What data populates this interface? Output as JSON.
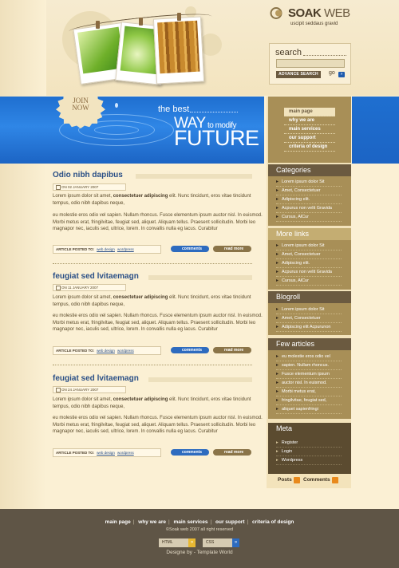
{
  "brand": {
    "name": "SOAK",
    "name_suffix": "WEB",
    "tagline": "uscipit seddaus gravid"
  },
  "search": {
    "label": "search",
    "advanced_label": "ADVANCE SEARCH",
    "go_label": "go",
    "go_arrow": "»"
  },
  "banner": {
    "join_line1": "JOIN",
    "join_line2": "NOW",
    "small": "the best",
    "way": "WAY",
    "way_suffix": "to modify",
    "future": "FUTURE"
  },
  "nav": [
    "main page",
    "why we are",
    "main services",
    "our support",
    "criteria of design"
  ],
  "categories": {
    "title": "Categories",
    "items": [
      "Lorem ipsum dolor Sit",
      "Amet, Consectetuer",
      "Adipiscing elit.",
      "Acpurus non velit Gravida",
      "Cursus, AlCur"
    ]
  },
  "more_links": {
    "title": "More links",
    "items": [
      "Lorem ipsum dolor Sit",
      "Amet, Consectetuer",
      "Adipiscing elit.",
      "Acpurus non velit Gravida",
      "Cursus, AlCur"
    ]
  },
  "blogroll": {
    "title": "Blogroll",
    "items": [
      "Lorem ipsum dolor Sit",
      "Amet, Consectetuer",
      "Adipiscing elit Acpurunon"
    ]
  },
  "few_articles": {
    "title": "Few articles",
    "items": [
      "eu molestie eros odio vel",
      "sapien. Nullam rhoncus.",
      "Fusce elementum ipsum",
      "auctor nisl. In euismod.",
      "Morbi metus erat,",
      "fringilvitae, feugiat sed,",
      "aliquet sapienfringi"
    ]
  },
  "meta": {
    "title": "Meta",
    "items": [
      "Register",
      "Login",
      "Wordpress"
    ]
  },
  "feeds": {
    "posts": "Posts",
    "comments": "Comments"
  },
  "posts": [
    {
      "title": "Odio nibh dapibus",
      "date": "ON 02 JANUARY 2007",
      "p1_start": "Lorem ipsum dolor sit amet, ",
      "p1_bold": "consectetuer adipiscing",
      "p1_end": " elit. Nunc tincidunt, eros vitae tincidunt tempus, odio nibh dapibus neque,",
      "p2": "eu molestie eros odio vel sapien. Nullam rhoncus. Fusce elementum ipsum auctor nisl. In euismod. Morbi metus erat, fringilvitae, feugiat sed, aliquet. Aliquam tellus. Praesent sollicitudin. Morbi leo magnapor nec, iaculis sed, ultrice, lorem. In convallis nulla eg lacus. Curabitur",
      "posted_to": "ARTICLE POSTED TO:",
      "tag1": "web design",
      "tag2": "wordpress",
      "comments": "comments",
      "read_more": "read more"
    },
    {
      "title": "feugiat sed lvitaemagn",
      "date": "ON 11 JANUARY 2007",
      "p1_start": "Lorem ipsum dolor sit amet, ",
      "p1_bold": "consectetuer adipiscing",
      "p1_end": " elit. Nunc tincidunt, eros vitae tincidunt tempus, odio nibh dapibus neque,",
      "p2": "eu molestie eros odio vel sapien. Nullam rhoncus. Fusce elementum ipsum auctor nisl. In euismod. Morbi metus erat, fringilvitae, feugiat sed, aliquet. Aliquam tellus. Praesent sollicitudin. Morbi leo magnapor nec, iaculis sed, ultrice, lorem. In convallis nulla eg lacus. Curabitur",
      "posted_to": "ARTICLE POSTED TO:",
      "tag1": "web design",
      "tag2": "wordpress",
      "comments": "comments",
      "read_more": "read more"
    },
    {
      "title": "feugiat sed lvitaemagn",
      "date": "ON 24 JANUARY 2007",
      "p1_start": "Lorem ipsum dolor sit amet, ",
      "p1_bold": "consectetuer adipiscing",
      "p1_end": " elit. Nunc tincidunt, eros vitae tincidunt tempus, odio nibh dapibus neque,",
      "p2": "eu molestie eros odio vel sapien. Nullam rhoncus. Fusce elementum ipsum auctor nisl. In euismod. Morbi metus erat, fringilvitae, feugiat sed, aliquet. Aliquam tellus. Praesent sollicitudin. Morbi leo magnapor nec, iaculis sed, ultrice, lorem. In convallis nulla eg lacus. Curabitur",
      "posted_to": "ARTICLE POSTED TO:",
      "tag1": "web design",
      "tag2": "wordpress",
      "comments": "comments",
      "read_more": "read more"
    }
  ],
  "footer": {
    "nav": [
      "main page",
      "why we are",
      "main services",
      "our support",
      "criteria of design"
    ],
    "separator": "|",
    "copyright": "©Soak web 2007 all right reserved",
    "html_badge": "HTML",
    "css_badge": "CSS",
    "badge_arrow": "»",
    "credits": "Designe by - Template World"
  },
  "colors": {
    "accent_blue": "#1f6fd0",
    "brown": "#a88f57",
    "dark_brown": "#6b5a40",
    "footer": "#5f5546",
    "title_blue": "#2a4f86"
  }
}
